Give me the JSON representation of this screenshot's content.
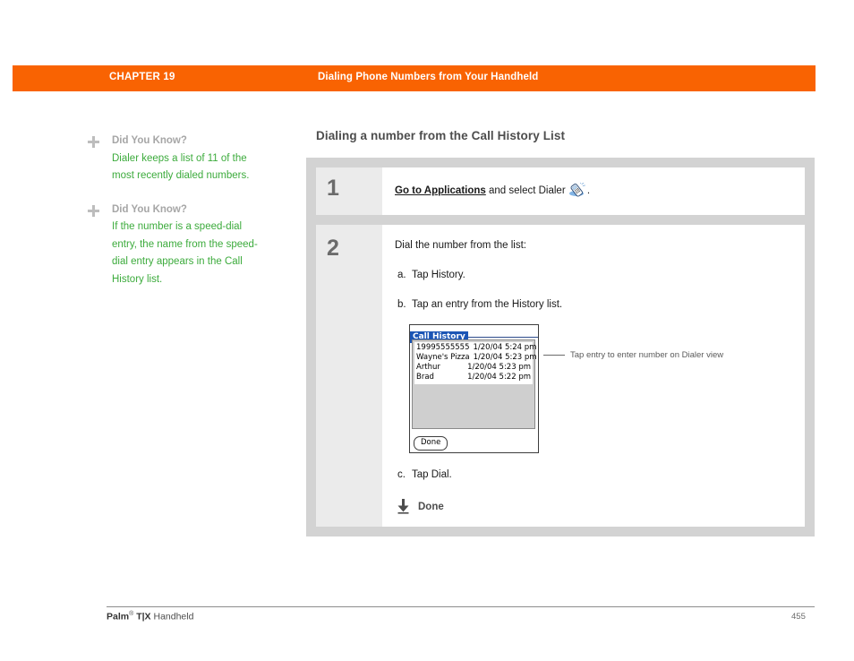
{
  "header": {
    "chapter_label": "CHAPTER 19",
    "chapter_title": "Dialing Phone Numbers from Your Handheld",
    "bar_color": "#f96302"
  },
  "sidebar": {
    "tips": [
      {
        "title": "Did You Know?",
        "body": "Dialer keeps a list of 11 of the most recently dialed numbers.",
        "icon": "plus-icon"
      },
      {
        "title": "Did You Know?",
        "body": "If the number is a speed-dial entry, the name from the speed-dial entry appears in the Call History list.",
        "icon": "plus-icon"
      }
    ],
    "title_color": "#a6a6a6",
    "body_color": "#3cab3c"
  },
  "main": {
    "section_heading": "Dialing a number from the Call History List",
    "steps": [
      {
        "number": "1",
        "text_link": "Go to Applications",
        "text_rest": " and select Dialer ",
        "text_end": ".",
        "icon": "dialer-phone-icon"
      },
      {
        "number": "2",
        "intro": "Dial the number from the list:",
        "substeps": [
          {
            "letter": "a.",
            "text": "Tap History."
          },
          {
            "letter": "b.",
            "text": "Tap an entry from the History list."
          },
          {
            "letter": "c.",
            "text": "Tap Dial."
          }
        ],
        "done_label": "Done",
        "done_icon": "down-arrow-to-bar-icon"
      }
    ],
    "screenshot": {
      "window_title": "Call History",
      "title_bg": "#1b55b5",
      "entries": [
        {
          "name": "19995555555",
          "time": "1/20/04 5:24 pm"
        },
        {
          "name": "Wayne's Pizza",
          "time": "1/20/04 5:23 pm"
        },
        {
          "name": "Arthur",
          "time": "1/20/04 5:23 pm"
        },
        {
          "name": "Brad",
          "time": "1/20/04 5:22 pm"
        }
      ],
      "done_button": "Done",
      "callout": "Tap entry to enter number on Dialer view"
    }
  },
  "footer": {
    "brand": "Palm",
    "registered": "®",
    "model": " T|X",
    "product": " Handheld",
    "page_number": "455"
  }
}
